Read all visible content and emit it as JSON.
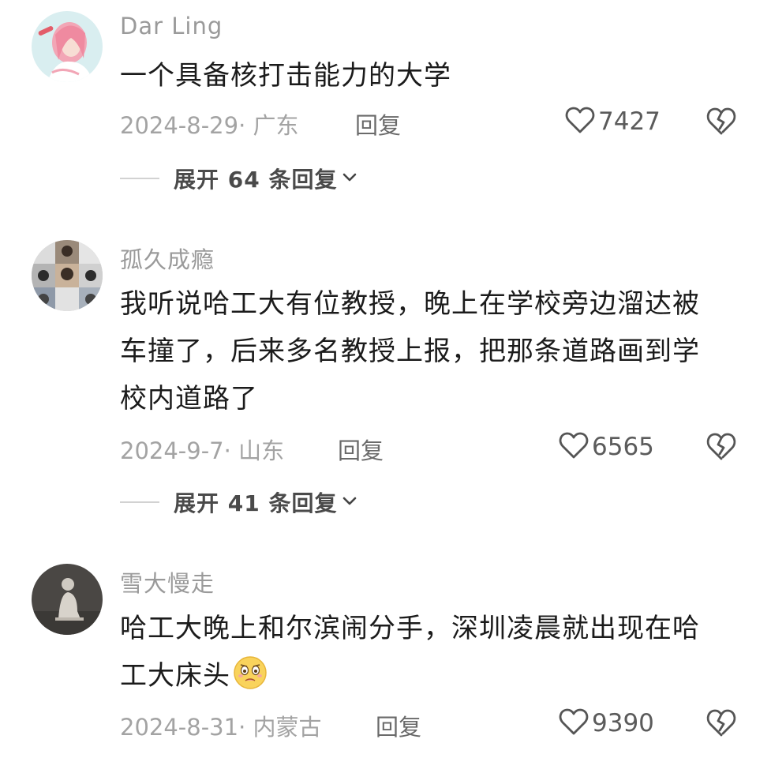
{
  "comments": [
    {
      "username": "Dar Ling",
      "text": "一个具备核打击能力的大学",
      "meta": "2024-8-29· 广东",
      "reply_label": "回复",
      "likes": "7427",
      "expand_label": "展开 64 条回复"
    },
    {
      "username": "孤久成瘾",
      "text_lines": [
        "我听说哈工大有位教授，晚上在学校旁边溜达被",
        "车撞了，后来多名教授上报，把那条道路画到学",
        "校内道路了"
      ],
      "meta": "2024-9-7· 山东",
      "reply_label": "回复",
      "likes": "6565",
      "expand_label": "展开 41 条回复"
    },
    {
      "username": "雪大慢走",
      "text_lines": [
        "哈工大晚上和尔滨闹分手，深圳凌晨就出现在哈",
        "工大床头"
      ],
      "meta": "2024-8-31· 内蒙古",
      "reply_label": "回复",
      "likes": "9390"
    }
  ],
  "icons": {
    "like": "heart-outline-icon",
    "dislike": "broken-heart-icon",
    "expand": "chevron-down-icon",
    "emoji": "worried-face-emoji"
  }
}
